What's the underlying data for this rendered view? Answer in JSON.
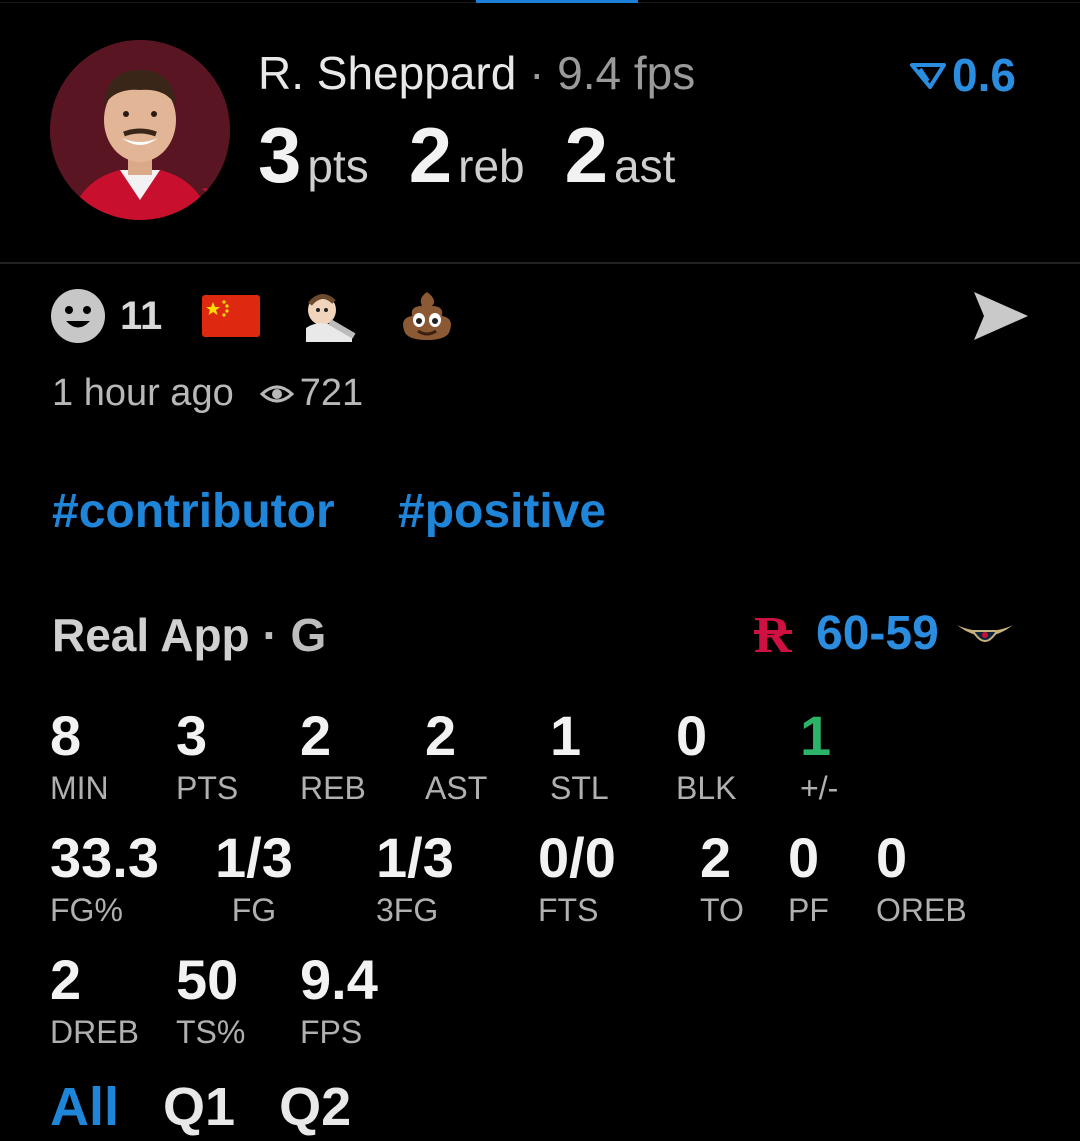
{
  "player": {
    "name": "R. Sheppard",
    "separator": "·",
    "fps": "9.4 fps",
    "tier_value": "0.6",
    "pts": "3",
    "pts_unit": "pts",
    "reb": "2",
    "reb_unit": "reb",
    "ast": "2",
    "ast_unit": "ast"
  },
  "reactions": {
    "count": "11",
    "emojis": [
      "china-flag-icon",
      "peter-griffin-sticker-icon",
      "poop-icon"
    ]
  },
  "meta": {
    "time": "1 hour ago",
    "views": "721"
  },
  "tags": [
    "#contributor",
    "#positive"
  ],
  "game": {
    "source": "Real App",
    "separator": "·",
    "position": "G",
    "score": "60-59"
  },
  "stats": [
    {
      "value": "8",
      "label": "MIN"
    },
    {
      "value": "3",
      "label": "PTS"
    },
    {
      "value": "2",
      "label": "REB"
    },
    {
      "value": "2",
      "label": "AST"
    },
    {
      "value": "1",
      "label": "STL"
    },
    {
      "value": "0",
      "label": "BLK"
    },
    {
      "value": "1",
      "label": "+/-"
    },
    {
      "value": "33.3",
      "label": "FG%"
    },
    {
      "value": "1/3",
      "label": "FG"
    },
    {
      "value": "1/3",
      "label": "3FG"
    },
    {
      "value": "0/0",
      "label": "FTS"
    },
    {
      "value": "2",
      "label": "TO"
    },
    {
      "value": "0",
      "label": "PF"
    },
    {
      "value": "0",
      "label": "OREB"
    },
    {
      "value": "2",
      "label": "DREB"
    },
    {
      "value": "50",
      "label": "TS%"
    },
    {
      "value": "9.4",
      "label": "FPS"
    }
  ],
  "periods": [
    "All",
    "Q1",
    "Q2"
  ],
  "colors": {
    "accent": "#1e85d8",
    "positive": "#2bb36a",
    "rockets_red": "#ce1141"
  }
}
